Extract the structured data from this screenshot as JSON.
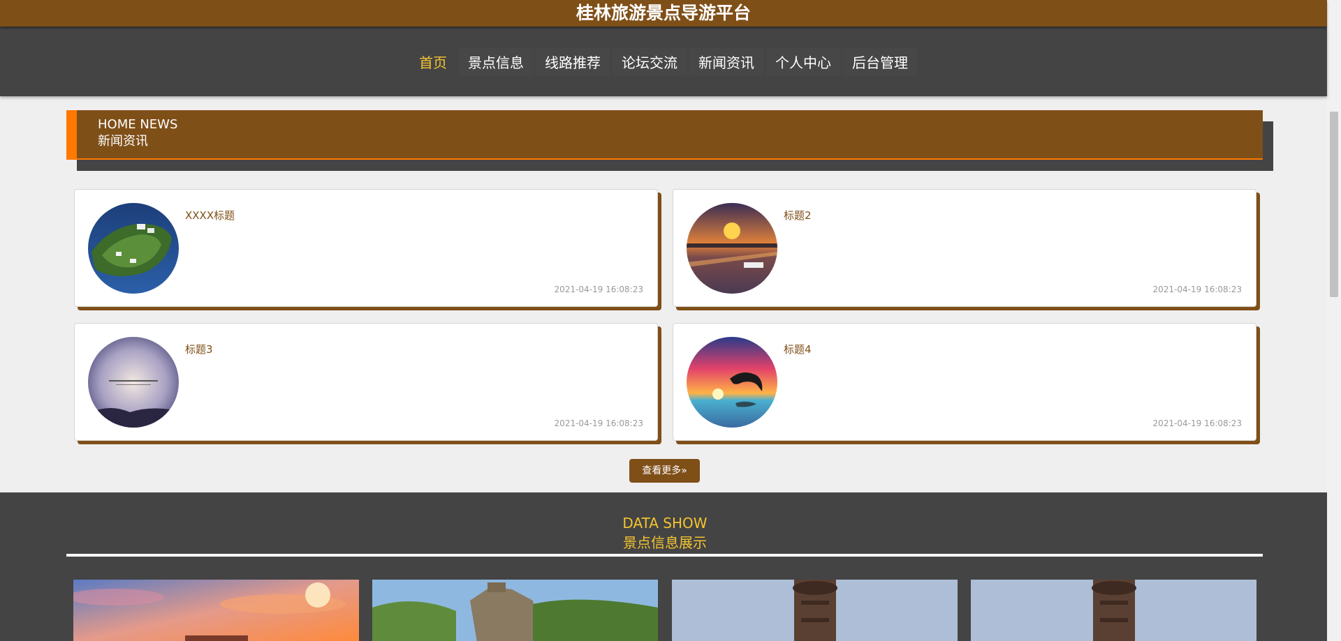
{
  "site_title": "桂林旅游景点导游平台",
  "nav": [
    {
      "label": "首页",
      "active": true
    },
    {
      "label": "景点信息",
      "active": false
    },
    {
      "label": "线路推荐",
      "active": false
    },
    {
      "label": "论坛交流",
      "active": false
    },
    {
      "label": "新闻资讯",
      "active": false
    },
    {
      "label": "个人中心",
      "active": false
    },
    {
      "label": "后台管理",
      "active": false
    }
  ],
  "news_section": {
    "title_en": "HOME NEWS",
    "title_cn": "新闻资讯",
    "items": [
      {
        "title": "XXXX标题",
        "date": "2021-04-19 16:08:23",
        "image": "island-photo"
      },
      {
        "title": "标题2",
        "date": "2021-04-19 16:08:23",
        "image": "sunset-river-photo"
      },
      {
        "title": "标题3",
        "date": "2021-04-19 16:08:23",
        "image": "dusk-grass-photo"
      },
      {
        "title": "标题4",
        "date": "2021-04-19 16:08:23",
        "image": "dolphin-sunset-photo"
      }
    ],
    "more_label": "查看更多",
    "more_icon": "double-chevron-right-icon"
  },
  "data_section": {
    "title_en": "DATA SHOW",
    "title_cn": "景点信息展示",
    "images": [
      "sunset-temple-photo",
      "great-wall-photo",
      "totem-pillar-photo",
      "totem-pillar-photo"
    ]
  },
  "colors": {
    "brand_brown": "#7f4f18",
    "nav_dark": "#444444",
    "accent_yellow": "#f4c431",
    "accent_orange": "#ff7800"
  }
}
